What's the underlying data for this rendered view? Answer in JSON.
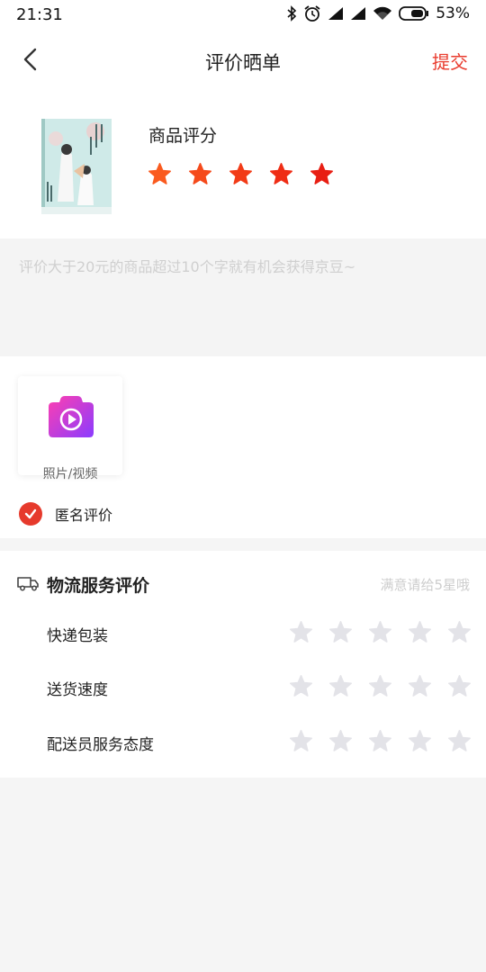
{
  "status_bar": {
    "time": "21:31",
    "battery": "53%",
    "icons": [
      "bluetooth-icon",
      "alarm-icon",
      "signal-icon",
      "signal-icon",
      "wifi-icon",
      "battery-icon"
    ]
  },
  "nav": {
    "back_icon": "chevron-left-icon",
    "title": "评价晒单",
    "submit_label": "提交"
  },
  "product": {
    "rating_label": "商品评分",
    "rating": 5,
    "max_rating": 5,
    "star_colors": [
      "#fa5a1e",
      "#f54a1b",
      "#f23b17",
      "#ef2d15",
      "#e81e13"
    ]
  },
  "review": {
    "placeholder": "评价大于20元的商品超过10个字就有机会获得京豆~"
  },
  "media": {
    "upload_label": "照片/视频",
    "anonymous_label": "匿名评价",
    "anonymous_checked": true
  },
  "logistics": {
    "title": "物流服务评价",
    "hint": "满意请给5星哦",
    "items": [
      {
        "label": "快递包装",
        "rating": 0
      },
      {
        "label": "送货速度",
        "rating": 0
      },
      {
        "label": "配送员服务态度",
        "rating": 0
      }
    ],
    "empty_star_color": "#e3e3e8",
    "accent": "#e93b2d"
  }
}
